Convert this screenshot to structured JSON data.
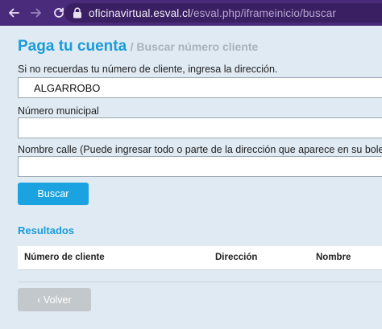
{
  "browser": {
    "url_host": "oficinavirtual.esval.cl",
    "url_path": "/esval.php/iframeinicio/buscar"
  },
  "page": {
    "title": "Paga tu cuenta",
    "subtitle": "/ Buscar número cliente",
    "instruction": "Si no recuerdas tu número de cliente, ingresa la dirección.",
    "comuna_value": "ALGARROBO",
    "numero_label": "Número municipal",
    "numero_value": "",
    "calle_label": "Nombre calle (Puede ingresar todo o parte de la dirección que aparece en su boleta)",
    "calle_value": "",
    "search_button": "Buscar",
    "results_title": "Resultados",
    "columns": [
      "Número de cliente",
      "Dirección",
      "Nombre"
    ],
    "back_button": "‹ Volver"
  },
  "colors": {
    "accent": "#1a9cd8",
    "button": "#1aa3e0",
    "disabled_button": "#c3c8cc",
    "browser_chrome": "#4a2a7a"
  }
}
